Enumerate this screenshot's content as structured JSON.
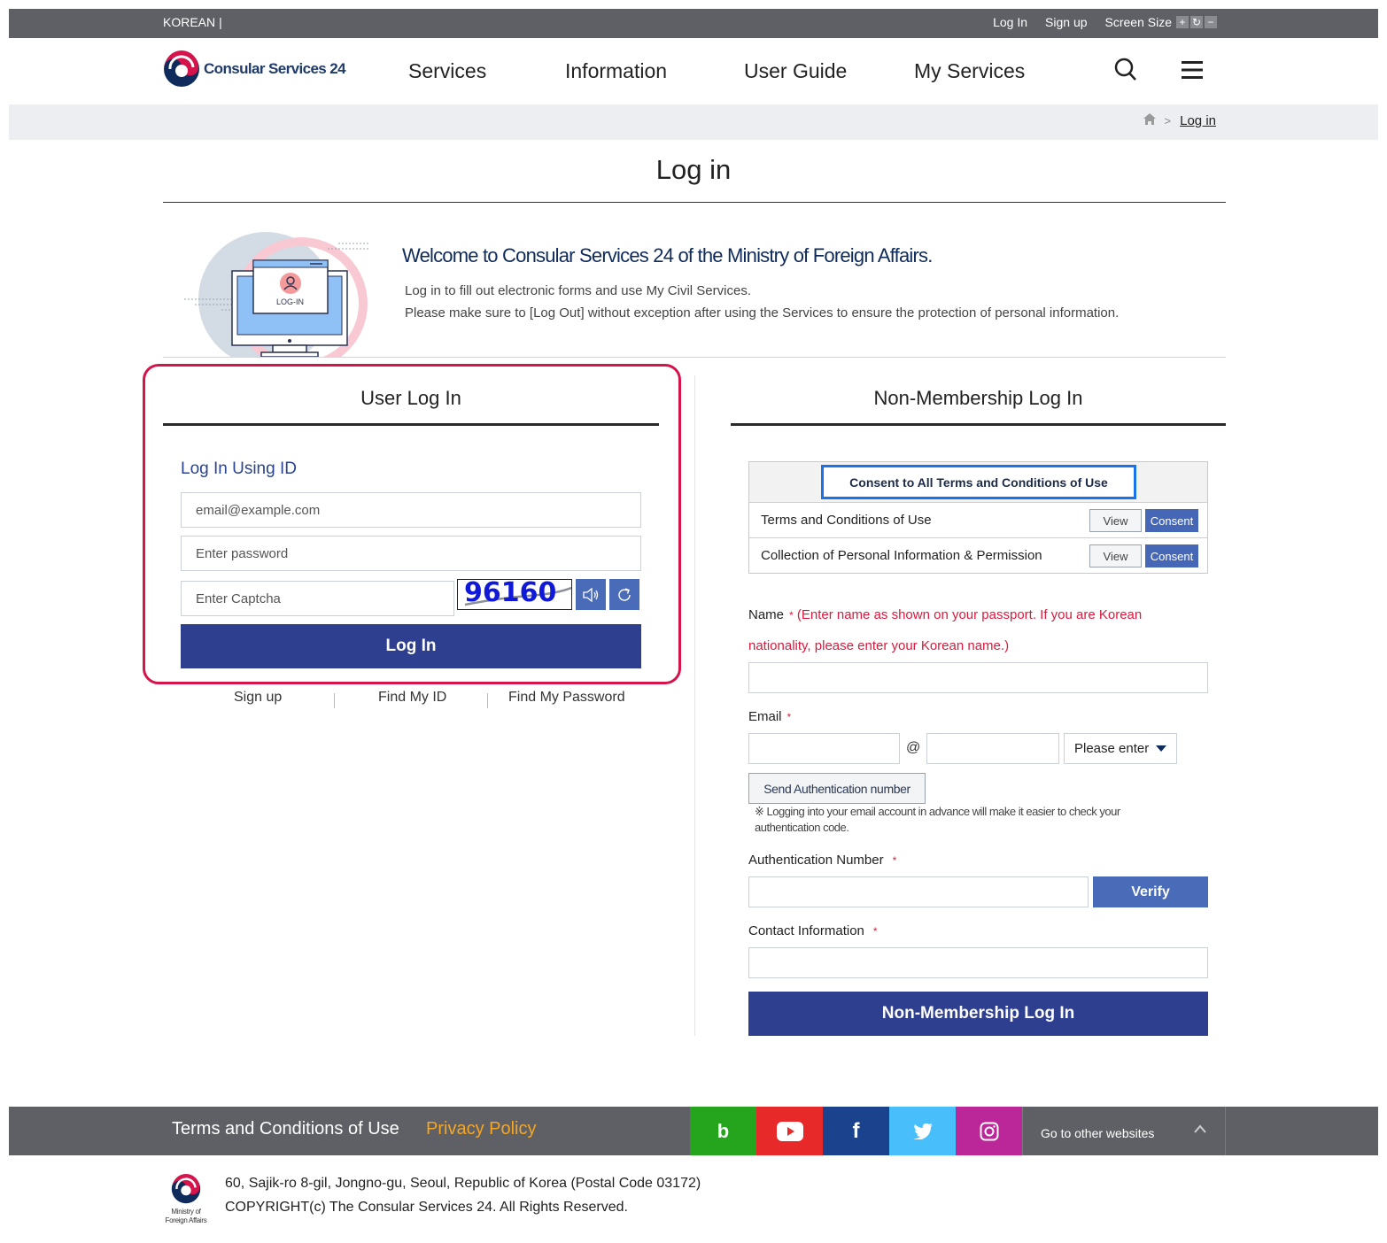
{
  "topbar": {
    "language": "KOREAN",
    "separator": "|",
    "login": "Log In",
    "signup": "Sign up",
    "screen_size_label": "Screen Size",
    "size_controls": [
      "+",
      "↻",
      "−"
    ]
  },
  "header": {
    "logo_text": "Consular Services 24",
    "nav": [
      "Services",
      "Information",
      "User Guide",
      "My Services"
    ],
    "icons": [
      "search-icon",
      "hamburger-menu-icon"
    ]
  },
  "breadcrumb": {
    "home_icon": "home-icon",
    "separator": ">",
    "current": "Log in"
  },
  "page": {
    "title": "Log in"
  },
  "welcome": {
    "illustration_label": "LOG-IN",
    "heading": "Welcome to Consular Services 24 of the Ministry of Foreign Affairs.",
    "line1": "Log in to fill out electronic forms and use My Civil Services.",
    "line2": "Please make sure to [Log Out] without exception after using the Services to ensure the protection of personal information."
  },
  "user_login": {
    "title": "User Log In",
    "subheading": "Log In Using ID",
    "email_placeholder": "email@example.com",
    "password_placeholder": "Enter password",
    "captcha_placeholder": "Enter Captcha",
    "captcha_value": "96160",
    "audio_icon": "speaker-icon",
    "refresh_icon": "refresh-icon",
    "login_button": "Log In",
    "links": [
      "Sign up",
      "Find My ID",
      "Find My Password"
    ],
    "highlight_color": "#d4144a"
  },
  "non_member_login": {
    "title": "Non-Membership Log In",
    "consent_all": "Consent to All Terms and Conditions of Use",
    "terms": [
      {
        "label": "Terms and Conditions of Use",
        "view": "View",
        "consent": "Consent"
      },
      {
        "label": "Collection of Personal Information & Permission",
        "view": "View",
        "consent": "Consent"
      }
    ],
    "name_label": "Name",
    "required_mark": "*",
    "name_hint_1": "(Enter name as shown on your passport. If you are Korean",
    "name_hint_2": "nationality, please enter your Korean name.)",
    "email_label": "Email",
    "at_sign": "@",
    "email_domain_select": "Please enter",
    "send_auth_button": "Send Authentication number",
    "auth_note": "※ Logging into your email account in advance will make it easier to check your authentication code.",
    "auth_number_label": "Authentication Number",
    "verify_button": "Verify",
    "contact_label": "Contact Information",
    "submit_button": "Non-Membership Log In"
  },
  "footer": {
    "terms_link": "Terms and Conditions of Use",
    "privacy_link": "Privacy Policy",
    "social": [
      {
        "name": "blog",
        "glyph": "b",
        "color": "#24a51d"
      },
      {
        "name": "youtube",
        "color": "#e8292a"
      },
      {
        "name": "facebook",
        "glyph": "f",
        "color": "#1b428c"
      },
      {
        "name": "twitter",
        "color": "#48befb"
      },
      {
        "name": "instagram",
        "color": "#bb2699"
      }
    ],
    "other_sites": "Go to other websites",
    "ministry_line1": "Ministry of",
    "ministry_line2": "Foreign Affairs",
    "address": "60, Sajik-ro 8-gil, Jongno-gu, Seoul, Republic of Korea (Postal Code 03172)",
    "copyright": "COPYRIGHT(c) The Consular Services 24. All Rights Reserved."
  },
  "colors": {
    "primary_navy": "#2e3f8f",
    "accent_blue": "#4a6bb8",
    "topbar_gray": "#5f6066",
    "required_red": "#e0183c",
    "privacy_orange": "#f5a623"
  }
}
